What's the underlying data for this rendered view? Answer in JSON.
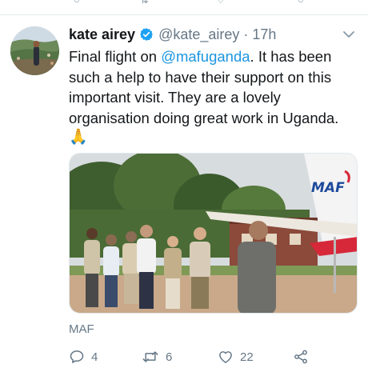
{
  "tweet": {
    "display_name": "kate airey",
    "handle": "@kate_airey",
    "separator": "·",
    "time": "17h",
    "text_intro": "Final flight on ",
    "mention": "@mafuganda",
    "text_rest": ". It has been such a help to have their support on this important visit. They are a lovely organisation doing great work in Uganda.",
    "emoji": "🙏",
    "source_label": "MAF",
    "photo_sign_text": "MAF",
    "counts": {
      "replies": "4",
      "retweets": "6",
      "likes": "22"
    }
  },
  "icons": {
    "verified": "verified-badge-icon",
    "caret": "chevron-down-icon",
    "reply": "reply-icon",
    "retweet": "retweet-icon",
    "like": "heart-icon",
    "share": "share-icon"
  },
  "colors": {
    "link": "#1b95e0",
    "secondary_text": "#657786",
    "icon_gray": "#657786",
    "verified_blue": "#1da1f2",
    "maf_red": "#d62839",
    "maf_blue": "#1e4a9c"
  }
}
